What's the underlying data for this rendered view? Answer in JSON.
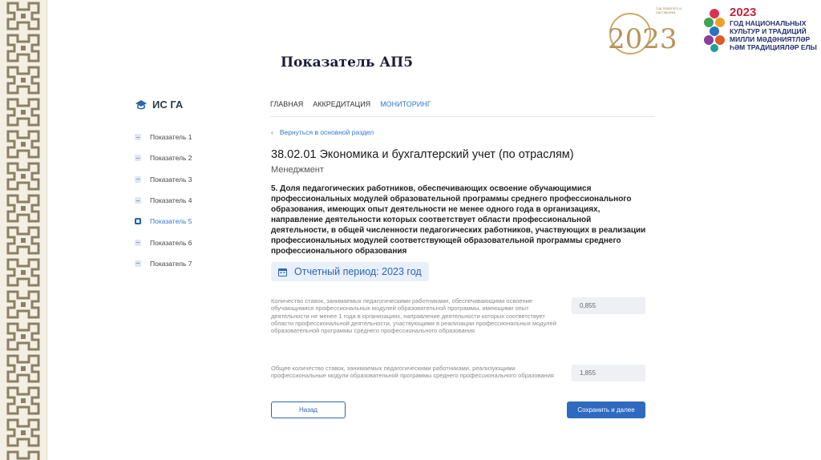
{
  "slide": {
    "title": "Показатель АП5"
  },
  "logos": {
    "year_logo": {
      "text": "2023",
      "small_text": "год педагога и наставника"
    },
    "national_year": {
      "year": "2023",
      "line1": "ГОД НАЦИОНАЛЬНЫХ",
      "line2": "КУЛЬТУР И ТРАДИЦИЙ",
      "line3": "МИЛЛИ МӘДӘНИЯТЛӘР",
      "line4": "ҺӘМ ТРАДИЦИЯЛӘР ЕЛЫ"
    }
  },
  "app": {
    "brand": "ИС ГА",
    "nav": [
      {
        "label": "ГЛАВНАЯ",
        "active": false
      },
      {
        "label": "АККРЕДИТАЦИЯ",
        "active": false
      },
      {
        "label": "МОНИТОРИНГ",
        "active": true
      }
    ],
    "sidebar": [
      {
        "label": "Показатель 1",
        "active": false
      },
      {
        "label": "Показатель 2",
        "active": false
      },
      {
        "label": "Показатель 3",
        "active": false
      },
      {
        "label": "Показатель 4",
        "active": false
      },
      {
        "label": "Показатель 5",
        "active": true
      },
      {
        "label": "Показатель 6",
        "active": false
      },
      {
        "label": "Показатель 7",
        "active": false
      }
    ],
    "back_link": "Вернуться в основной раздел",
    "program_title": "38.02.01 Экономика и бухгалтерский учет (по отраслям)",
    "program_subtitle": "Менеджмент",
    "question": "5. Доля педагогических работников, обеспечивающих освоение обучающимися профессиональных модулей образовательной программы среднего профессионального образования, имеющих опыт деятельности не менее одного года в организациях, направление деятельности которых соответствует области профессиональной деятельности, в общей численности педагогических работников, участвующих в реализации профессиональных модулей соответствующей образовательной программы среднего профессионального образования",
    "period": "Отчетный период: 2023 год",
    "fields": [
      {
        "label": "Количество ставок, занимаемых педагогическими работниками, обеспечивающими освоение обучающимися профессиональных модулей образовательной программы, имеющими опыт деятельности не менее 1 года в организациях, направление деятельности которых соответствует области профессиональной деятельности, участвующими в реализации профессиональных модулей образовательной программы среднего профессионального образования",
        "value": "0,855"
      },
      {
        "label": "Общее количество ставок, занимаемых педагогическими работниками, реализующими профессиональные модули образовательной программы среднего профессионального образования",
        "value": "1,855"
      }
    ],
    "buttons": {
      "back": "Назад",
      "save": "Сохранить и далее"
    }
  }
}
